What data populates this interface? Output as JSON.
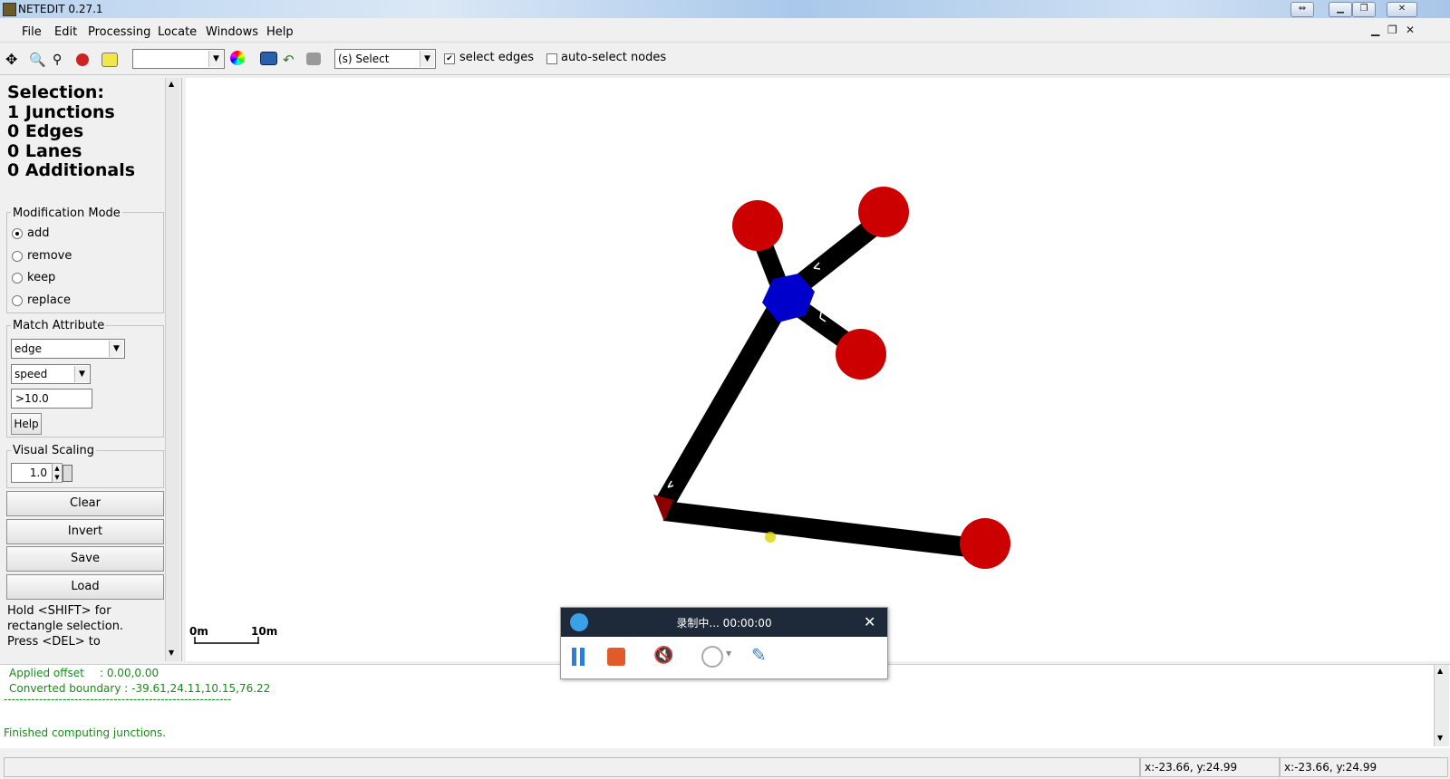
{
  "window": {
    "title": "NETEDIT 0.27.1"
  },
  "menu": [
    "File",
    "Edit",
    "Processing",
    "Locate",
    "Windows",
    "Help"
  ],
  "toolbar": {
    "edit_mode": "(s) Select",
    "select_edges_label": "select edges",
    "select_edges_checked": true,
    "auto_select_nodes_label": "auto-select nodes",
    "auto_select_nodes_checked": false
  },
  "selection": {
    "heading": "Selection:",
    "lines": [
      "1 Junctions",
      "0 Edges",
      "0 Lanes",
      "0 Additionals"
    ]
  },
  "modification_mode": {
    "title": "Modification Mode",
    "options": [
      "add",
      "remove",
      "keep",
      "replace"
    ],
    "selected": "add"
  },
  "match_attribute": {
    "title": "Match Attribute",
    "element_type": "edge",
    "attribute": "speed",
    "expression": ">10.0",
    "help_label": "Help"
  },
  "visual_scaling": {
    "title": "Visual Scaling",
    "value": "1.0"
  },
  "buttons": {
    "clear": "Clear",
    "invert": "Invert",
    "save": "Save",
    "load": "Load"
  },
  "hint": [
    "Hold <SHIFT> for",
    "rectangle selection.",
    "Press <DEL> to"
  ],
  "scale": {
    "start": "0m",
    "end": "10m"
  },
  "messages": {
    "offset_label": "Applied offset",
    "offset_value": ": 0.00,0.00",
    "boundary": "Converted boundary : -39.61,24.11,10.15,76.22",
    "separator": "----------------------------------------------------------",
    "finished": "Finished computing junctions."
  },
  "status": {
    "coord1": "x:-23.66, y:24.99",
    "coord2": "x:-23.66, y:24.99"
  },
  "recorder": {
    "title": "录制中... 00:00:00"
  },
  "colors": {
    "junction_selected": "#0000cc",
    "junction": "#cc0000",
    "edge": "#000000"
  }
}
